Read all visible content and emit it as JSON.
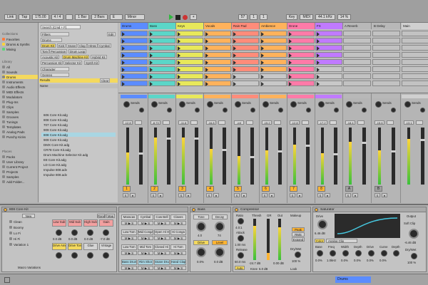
{
  "transport": {
    "link": "Link",
    "tap": "Tap",
    "tempo": "175.00",
    "sig": "4 / 4",
    "metro": "1 Bar",
    "quant": "2 Bars",
    "key": "E",
    "scale": "Minor",
    "pos": "57",
    "beat": "1",
    "sub": "1",
    "keyLbl": "Key",
    "midi": "MIDI",
    "rate": "44.1 kHz",
    "cpu": "14 %"
  },
  "browser": {
    "collections_title": "Collections",
    "collections": [
      "Favorites",
      "Drums & Synths",
      "Mixing"
    ],
    "library_title": "Library",
    "library": [
      "All",
      "Sounds",
      "Drums",
      "Instruments",
      "Audio Effects",
      "MIDI Effects",
      "Modulators",
      "Plug-Ins",
      "Clips",
      "Samples",
      "Grooves",
      "Tunings",
      "Templates",
      "Analog Pads",
      "Punchy Kicks"
    ],
    "places_title": "Places",
    "places": [
      "Packs",
      "User Library",
      "Current Project",
      "Projects",
      "Samples",
      "Add Folder..."
    ],
    "search_placeholder": "Search (Cmd + F)",
    "filters": "Filters",
    "edit": "Edit",
    "filter_dropdown": "Drums",
    "tags": [
      "Drum Kit",
      "Kick",
      "Snare",
      "Clap",
      "HiHat",
      "Cymbal",
      "Tom",
      "Percussion",
      "Drum Loop",
      "Acoustic Kit",
      "Drum Machine Kit",
      "Hybrid Kit",
      "Percussion Kit",
      "Selector Kit",
      "Synth Kit"
    ],
    "character": "Character",
    "genres": "Genres",
    "results": "Results",
    "clear": "Clear",
    "name_col": "Name",
    "files": [
      "606 Core Kit.adg",
      "808 Core Kit.adg",
      "707 Core Kit.adg",
      "909 Core Kit.adg",
      "808 Core Kit.adg",
      "909 Core Kit.adg",
      "DMX Core Kit.adg",
      "CR78 Core Kit.adg",
      "Drum Machine Selector Kit.adg",
      "E8 Core Kit.adg",
      "LD Core Kit.adg",
      "Impulse 808.adv",
      "Impulse 808.adv"
    ]
  },
  "tracks": [
    {
      "name": "Drums",
      "color": "#5b8cff",
      "num": "1"
    },
    {
      "name": "Bass",
      "color": "#5bd6c8",
      "num": "2"
    },
    {
      "name": "Keys",
      "color": "#e8e85a",
      "num": "3"
    },
    {
      "name": "Vocals",
      "color": "#ffb25b",
      "num": "4"
    },
    {
      "name": "Rain Pad",
      "color": "#ff8c7a",
      "num": "5"
    },
    {
      "name": "Ambience",
      "color": "#ffb25b",
      "num": "6"
    },
    {
      "name": "Drone",
      "color": "#ff7aa8",
      "num": "7"
    },
    {
      "name": "FX",
      "color": "#c07aff",
      "num": "8"
    },
    {
      "name": "A Reverb",
      "color": "#b8b8b8",
      "num": "A"
    },
    {
      "name": "B Delay",
      "color": "#b8b8b8",
      "num": "B"
    },
    {
      "name": "Main",
      "color": "#d0d0d0",
      "num": ""
    }
  ],
  "mixer": {
    "sends": "Sends",
    "vols": [
      "-12.8",
      "-8.73",
      "-11.8",
      "-16.8",
      "-inf",
      "-15.2",
      "-12.8",
      "-17.2",
      "-18.4",
      "-15.6",
      "-13.1"
    ],
    "post": "Post",
    "scale": [
      "0",
      "-12",
      "-24",
      "-36",
      "-48",
      "-60"
    ]
  },
  "devices": {
    "drumrack": {
      "title": "808 Core Kit",
      "new": "New",
      "rand": "Rand",
      "map": "Map",
      "macros": [
        "Low Sub",
        "Mid Sub",
        "High Sub",
        "Gain",
        "Drive Amount",
        "Drive Tone",
        "Glue",
        "Vintage"
      ],
      "macro_vals": [
        "0.0 dB",
        "0.0 dB",
        "0.0 dB",
        "-7.0 dB"
      ],
      "variations": [
        "Clean",
        "Boomy",
        "Lo Fi",
        "Hi Fi",
        "Variation 1"
      ],
      "macro_var": "Macro Variations"
    },
    "pads": {
      "cells": [
        "Maracas",
        "Cymbal",
        "Cow Bell",
        "Claves",
        "Low Tom",
        "Mid Conga",
        "Open Hi Hat",
        "Hi Conga",
        "Low Tom",
        "Mid Tom",
        "Closed Hi Hat",
        "Hi Tom",
        "Bass Drum",
        "Rim Shot",
        "Snare Drum",
        "Hand Clap"
      ]
    },
    "bass": {
      "title": "Bass",
      "tone": "Tone",
      "decay": "Decay",
      "drive": "Drive",
      "level": "Level",
      "tone_v": "4.0",
      "decay_v": "74",
      "drive_v": "0.0%",
      "level_v": "0.0 dB"
    },
    "comp": {
      "title": "Compressor",
      "ratio": "Ratio",
      "ratio_v": "4.0:1",
      "attack": "Attack",
      "attack_v": "1.00 ms",
      "release": "Release",
      "release_v": "50.0 ms",
      "thresh": "Thresh",
      "gr": "GR",
      "out": "Out",
      "thr_v": "-24.7 dB",
      "out_v": "0.00 dB",
      "makeup": "Makeup",
      "peak": "Peak",
      "rms": "RMS",
      "expand": "Expand",
      "knee": "Knee",
      "knee_v": "6.0 dB",
      "look": "Look",
      "drywet": "Dry/Wet",
      "dw_v": "100 %",
      "auto": "Auto"
    },
    "sat": {
      "title": "Saturator",
      "drive": "Drive",
      "drive_v": "6.46 dB",
      "color": "Color",
      "curve": "Analog Clip",
      "base": "Base",
      "freq": "Freq",
      "width": "Width",
      "depth": "Depth",
      "drive2": "Drive",
      "curve2": "Curve",
      "depth2": "Depth",
      "output": "Output",
      "out_v": "-6.46 dB",
      "softclip": "Soft Clip",
      "drywet": "Dry/Wet",
      "dw_v": "100 %",
      "vals": [
        "0.0%",
        "1.0kHz",
        "0.0%",
        "0.0%",
        "0.0%",
        "0.0%"
      ]
    }
  },
  "status": {
    "track": "Drums"
  }
}
